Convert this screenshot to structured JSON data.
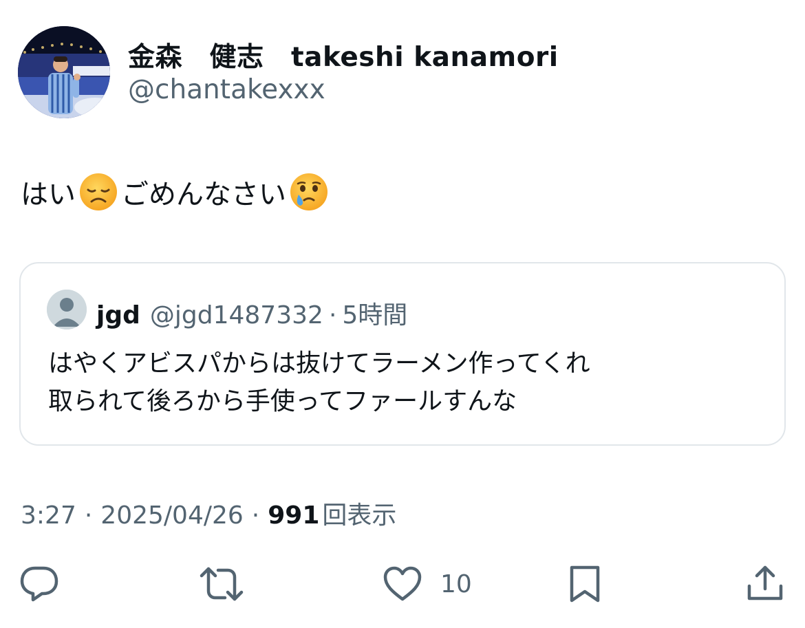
{
  "author": {
    "display_name": "金森　健志　takeshi kanamori",
    "handle": "@chantakexxx"
  },
  "tweet": {
    "text_part1": "はい",
    "emoji1": "disappointed-face",
    "text_part2": "ごめんなさい",
    "emoji2": "face-holding-back-tears"
  },
  "quote": {
    "name": "jgd",
    "handle": "@jgd1487332",
    "separator": "·",
    "time": "5時間",
    "line1": "はやくアビスパからは抜けてラーメン作ってくれ",
    "line2": "取られて後ろから手使ってファールすんな"
  },
  "meta": {
    "time": "3:27",
    "separator": "·",
    "date": "2025/04/26",
    "views_count": "991",
    "views_label": "回表示"
  },
  "actions": {
    "reply_icon": "reply-icon",
    "retweet_icon": "retweet-icon",
    "like_icon": "heart-icon",
    "like_count": "10",
    "bookmark_icon": "bookmark-icon",
    "share_icon": "share-icon"
  },
  "colors": {
    "text_primary": "#0f1419",
    "text_secondary": "#536471",
    "border": "#e1e6ea"
  }
}
